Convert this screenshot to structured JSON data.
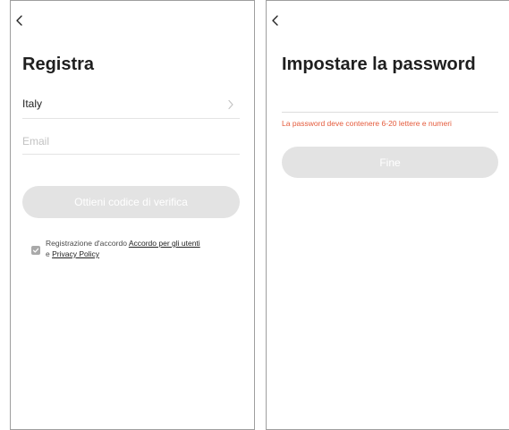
{
  "register": {
    "title": "Registra",
    "country": "Italy",
    "email_placeholder": "Email",
    "verify_button": "Ottieni codice di verifica",
    "agreement": {
      "prefix": "Registrazione d'accordo ",
      "user_agreement_link": "Accordo per gli utenti",
      "conjunction": "e ",
      "privacy_link": "Privacy Policy",
      "checked": true
    }
  },
  "set_password": {
    "title": "Impostare la password",
    "password_value": "",
    "error_text": "La password deve contenere 6-20 lettere e numeri",
    "done_button": "Fine"
  },
  "colors": {
    "disabled_button": "#e3e3e3",
    "error": "#e45b3c",
    "divider": "#e4e4e4"
  },
  "icons": {
    "back": "chevron-left-icon",
    "country_arrow": "chevron-right-icon",
    "checkbox": "checkmark-icon"
  }
}
